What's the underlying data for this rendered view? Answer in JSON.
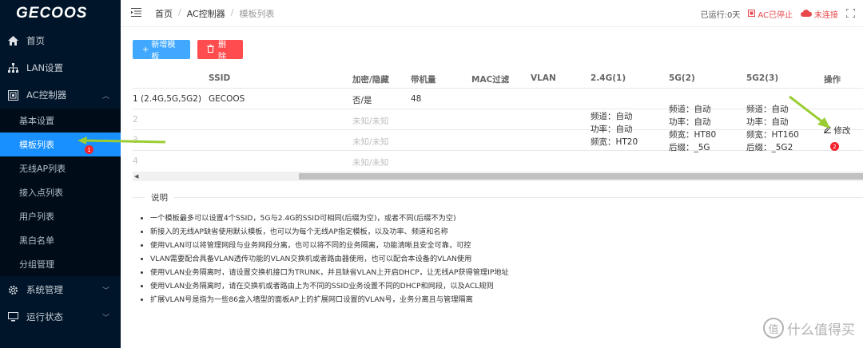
{
  "app": {
    "logo": "GECOOS"
  },
  "sidebar": {
    "items": [
      {
        "label": "首页",
        "icon": "home-icon"
      },
      {
        "label": "LAN设置",
        "icon": "network-icon"
      },
      {
        "label": "AC控制器",
        "icon": "controller-icon",
        "expanded": true
      }
    ],
    "sub_items": [
      {
        "label": "基本设置"
      },
      {
        "label": "模板列表",
        "active": true,
        "badge": "1"
      },
      {
        "label": "无线AP列表"
      },
      {
        "label": "接入点列表"
      },
      {
        "label": "用户列表"
      },
      {
        "label": "黑白名单"
      },
      {
        "label": "分组管理"
      }
    ],
    "bottom_items": [
      {
        "label": "系统管理",
        "icon": "gear-icon"
      },
      {
        "label": "运行状态",
        "icon": "monitor-icon"
      }
    ]
  },
  "header": {
    "breadcrumb": [
      "首页",
      "AC控制器",
      "模板列表"
    ],
    "status": {
      "uptime": "已运行:0天",
      "ac_state": "AC已停止",
      "cloud": "未连接"
    }
  },
  "toolbar": {
    "add_label": "新增模板",
    "delete_label": "删除"
  },
  "table": {
    "headers": [
      "SSID",
      "加密/隐藏",
      "带机量",
      "MAC过滤",
      "VLAN",
      "2.4G(1)",
      "5G(2)",
      "5G2(3)",
      "操作"
    ],
    "rows": [
      {
        "index": "1 (2.4G,5G,5G2)",
        "ssid": "GECOOS",
        "enc": "否/是",
        "load": "48"
      },
      {
        "index": "2",
        "enc": "未知/未知"
      },
      {
        "index": "3",
        "enc": "未知/未知"
      },
      {
        "index": "4",
        "enc": "未知/未知"
      }
    ],
    "radio_24": [
      "频道：自动",
      "功率：自动",
      "频宽：HT20"
    ],
    "radio_5": [
      "频道：自动",
      "功率：自动",
      "频宽：HT80",
      "后缀：_5G"
    ],
    "radio_5g2": [
      "频道：自动",
      "功率：自动",
      "频宽：HT160",
      "后缀：_5G2"
    ],
    "edit_label": "修改",
    "edit_badge": "2"
  },
  "notes": {
    "title": "说明",
    "items": [
      "一个模板最多可以设置4个SSID，5G与2.4G的SSID可相同(后缀为空)，或者不同(后缀不为空)",
      "新接入的无线AP缺省使用默认模板，也可以为每个无线AP指定模板，以及功率、频道和名称",
      "使用VLAN可以将管理网段与业务网段分离，也可以将不同的业务隔离，功能清晰且安全可靠，可控",
      "VLAN需要配合具备VLAN透传功能的VLAN交换机或者路由器使用，也可以配合本设备的VLAN使用",
      "使用VLAN业务隔离时，请设置交换机接口为TRUNK，并且缺省VLAN上开启DHCP，让无线AP获得管理IP地址",
      "使用VLAN业务隔离时，请在交换机或者路由上为不同的SSID业务设置不同的DHCP和网段，以及ACL规则",
      "扩展VLAN号是指为一些86盒入墙型的面板AP上的扩展网口设置的VLAN号，业务分离且与管理隔离"
    ]
  },
  "watermark": {
    "text": "什么值得买",
    "mark": "值"
  },
  "colors": {
    "sidebar": "#001529",
    "active": "#1890ff",
    "add_button": "#40a9ff",
    "delete_button": "#ff4d4f",
    "alert": "#e8474c"
  }
}
